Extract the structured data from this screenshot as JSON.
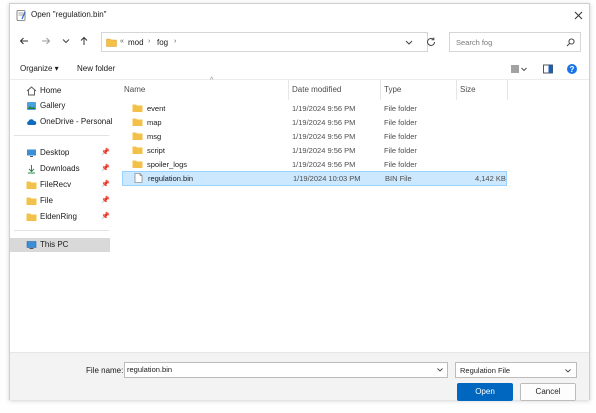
{
  "window": {
    "title": "Open \"regulation.bin\""
  },
  "address": {
    "chevron": "«",
    "segments": [
      "mod",
      "fog"
    ],
    "separator": "›",
    "search_placeholder": "Search fog"
  },
  "commands": {
    "organize": "Organize ▾",
    "new_folder": "New folder"
  },
  "sidebar": {
    "quick": [
      {
        "label": "Home",
        "icon": "home-icon"
      },
      {
        "label": "Gallery",
        "icon": "gallery-icon"
      },
      {
        "label": "OneDrive - Personal",
        "icon": "onedrive-icon"
      }
    ],
    "pinned": [
      {
        "label": "Desktop",
        "icon": "desktop-icon",
        "pin": "📌"
      },
      {
        "label": "Downloads",
        "icon": "download-icon",
        "pin": "📌"
      },
      {
        "label": "FileRecv",
        "icon": "folder-icon",
        "pin": "📌"
      },
      {
        "label": "File",
        "icon": "folder-icon",
        "pin": "📌"
      },
      {
        "label": "EldenRing",
        "icon": "folder-icon",
        "pin": "📌"
      }
    ],
    "this_pc": "This PC"
  },
  "columns": {
    "name": "Name",
    "date": "Date modified",
    "type": "Type",
    "size": "Size"
  },
  "files": [
    {
      "name": "event",
      "date": "1/19/2024 9:56 PM",
      "type": "File folder",
      "size": "",
      "kind": "folder"
    },
    {
      "name": "map",
      "date": "1/19/2024 9:56 PM",
      "type": "File folder",
      "size": "",
      "kind": "folder"
    },
    {
      "name": "msg",
      "date": "1/19/2024 9:56 PM",
      "type": "File folder",
      "size": "",
      "kind": "folder"
    },
    {
      "name": "script",
      "date": "1/19/2024 9:56 PM",
      "type": "File folder",
      "size": "",
      "kind": "folder"
    },
    {
      "name": "spoiler_logs",
      "date": "1/19/2024 9:56 PM",
      "type": "File folder",
      "size": "",
      "kind": "folder"
    },
    {
      "name": "regulation.bin",
      "date": "1/19/2024 10:03 PM",
      "type": "BIN File",
      "size": "4,142 KB",
      "kind": "file",
      "selected": true
    }
  ],
  "footer": {
    "filename_label": "File name:",
    "filename_value": "regulation.bin",
    "filetype": "Regulation File",
    "open_label": "Open",
    "cancel_label": "Cancel"
  },
  "colors": {
    "folder": "#f3c04a",
    "accent": "#0067c0",
    "selection": "#cce8ff"
  }
}
